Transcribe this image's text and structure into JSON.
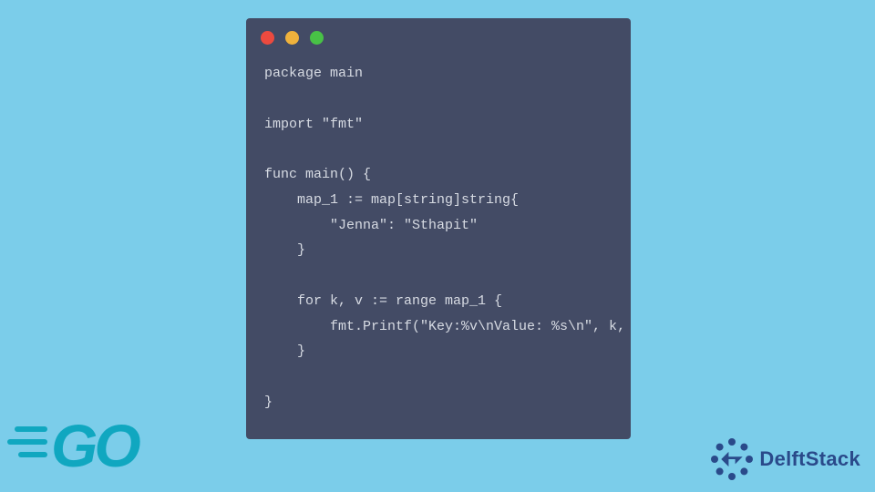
{
  "code": {
    "line1": "package main",
    "line2": "",
    "line3": "import \"fmt\"",
    "line4": "",
    "line5": "func main() {",
    "line6": "    map_1 := map[string]string{",
    "line7": "        \"Jenna\": \"Sthapit\"",
    "line8": "    }",
    "line9": "",
    "line10": "    for k, v := range map_1 {",
    "line11": "        fmt.Printf(\"Key:%v\\nValue: %s\\n\", k, v)",
    "line12": "    }",
    "line13": "",
    "line14": "}"
  },
  "brand": {
    "go": "GO",
    "delft": "DelftStack"
  },
  "colors": {
    "bg": "#7bcdea",
    "window": "#434b65",
    "text": "#d7dbe3",
    "go": "#10a7c0",
    "delft": "#2a4a8a"
  }
}
